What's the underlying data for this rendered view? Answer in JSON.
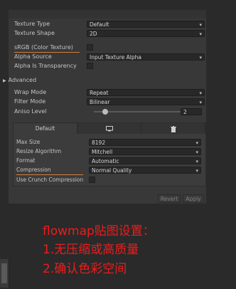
{
  "fields": {
    "texture_type": {
      "label": "Texture Type",
      "value": "Default"
    },
    "texture_shape": {
      "label": "Texture Shape",
      "value": "2D"
    },
    "srgb": {
      "label": "sRGB (Color Texture)",
      "checked": false
    },
    "alpha_source": {
      "label": "Alpha Source",
      "value": "Input Texture Alpha"
    },
    "alpha_transparency": {
      "label": "Alpha Is Transparency",
      "checked": false
    }
  },
  "advanced": {
    "label": "Advanced"
  },
  "wrap": {
    "wrap_mode": {
      "label": "Wrap Mode",
      "value": "Repeat"
    },
    "filter_mode": {
      "label": "Filter Mode",
      "value": "Bilinear"
    },
    "aniso_level": {
      "label": "Aniso Level",
      "value": "2",
      "slider_fraction": 0.12
    }
  },
  "platform": {
    "tabs": [
      {
        "label": "Default",
        "icon": "monitor-icon"
      },
      {
        "icon": "trash-icon"
      }
    ],
    "max_size": {
      "label": "Max Size",
      "value": "8192"
    },
    "resize": {
      "label": "Resize Algorithm",
      "value": "Mitchell"
    },
    "format": {
      "label": "Format",
      "value": "Automatic"
    },
    "compression": {
      "label": "Compression",
      "value": "Normal Quality"
    },
    "crunch": {
      "label": "Use Crunch Compression",
      "checked": false
    }
  },
  "buttons": {
    "revert": "Revert",
    "apply": "Apply"
  },
  "annotation": {
    "line1": "flowmap贴图设置：",
    "line2": "1.无压缩或高质量",
    "line3": "2.确认色彩空间",
    "color": "#ee1c1c"
  }
}
